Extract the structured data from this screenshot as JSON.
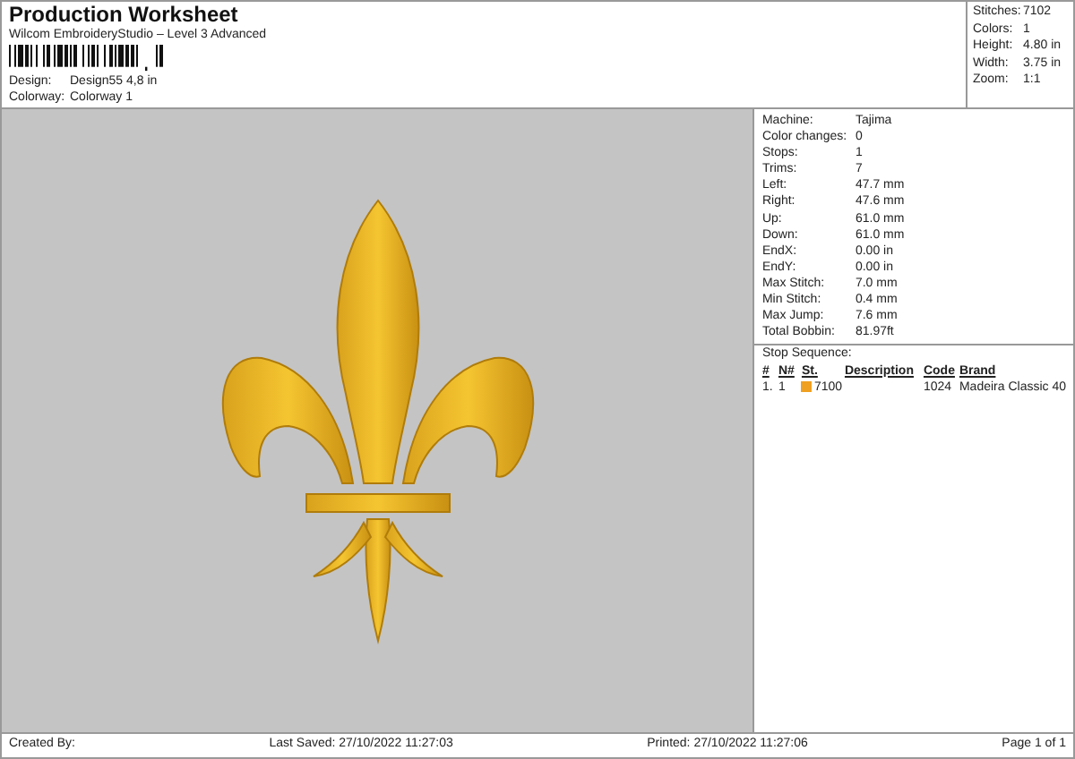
{
  "header": {
    "title": "Production Worksheet",
    "subtitle": "Wilcom EmbroideryStudio – Level 3 Advanced",
    "fields": [
      {
        "label": "Design:",
        "value": "Design55 4,8 in"
      },
      {
        "label": "Colorway:",
        "value": "Colorway 1"
      }
    ]
  },
  "summary": [
    {
      "label": "Stitches:",
      "value": "7102"
    },
    {
      "label": "Colors:",
      "value": "1"
    },
    {
      "label": "Height:",
      "value": "4.80 in"
    },
    {
      "label": "Width:",
      "value": "3.75 in"
    },
    {
      "label": "Zoom:",
      "value": "1:1"
    }
  ],
  "details": [
    {
      "label": "Machine:",
      "value": "Tajima"
    },
    {
      "label": "Color changes:",
      "value": "0"
    },
    {
      "label": "Stops:",
      "value": "1"
    },
    {
      "label": "Trims:",
      "value": "7"
    },
    {
      "label": "Left:",
      "value": "47.7 mm"
    },
    {
      "label": "Right:",
      "value": "47.6 mm"
    },
    {
      "label": "Up:",
      "value": "61.0 mm"
    },
    {
      "label": "Down:",
      "value": "61.0 mm"
    },
    {
      "label": "EndX:",
      "value": "0.00 in"
    },
    {
      "label": "EndY:",
      "value": "0.00 in"
    },
    {
      "label": "Max Stitch:",
      "value": "7.0 mm"
    },
    {
      "label": "Min Stitch:",
      "value": "0.4 mm"
    },
    {
      "label": "Max Jump:",
      "value": "7.6 mm"
    },
    {
      "label": "Total Bobbin:",
      "value": "81.97ft"
    }
  ],
  "stop_sequence": {
    "title": "Stop Sequence:",
    "columns": [
      "#",
      "N#",
      "St.",
      "Description",
      "Code",
      "Brand"
    ],
    "rows": [
      {
        "number": "1.",
        "needle": "1",
        "color": "#f0a020",
        "stitches": "7100",
        "description": "",
        "code": "1024",
        "brand": "Madeira Classic 40"
      }
    ]
  },
  "footer": {
    "created_by": "Created By:",
    "last_saved": "Last Saved: 27/10/2022 11:27:03",
    "printed": "Printed: 27/10/2022 11:27:06",
    "page": "Page 1 of 1"
  }
}
